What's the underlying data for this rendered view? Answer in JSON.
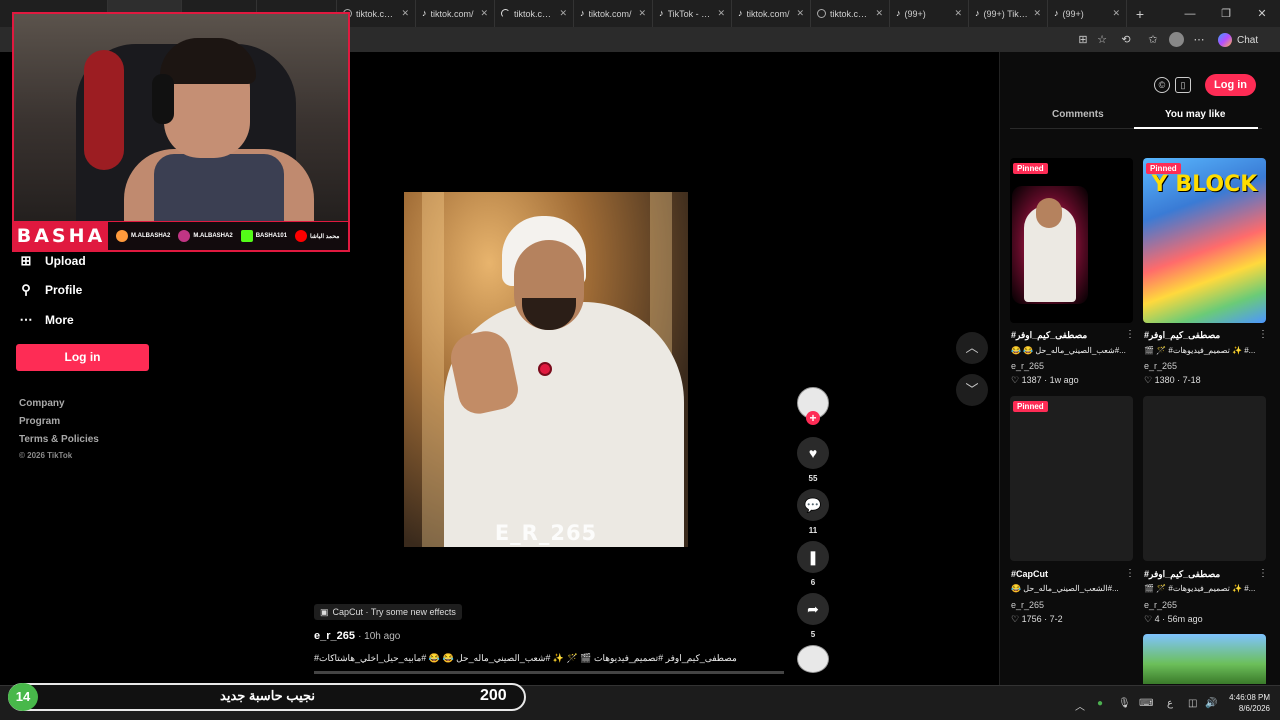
{
  "browser": {
    "tabs": [
      {
        "label": "tiktok.com/",
        "icon": "globe-icon"
      },
      {
        "label": "tiktok.com/",
        "icon": "tiktok-icon"
      },
      {
        "label": "tiktok.com/",
        "icon": "loading-icon"
      },
      {
        "label": "tiktok.com/",
        "icon": "tiktok-icon"
      },
      {
        "label": "TikTok - Ma",
        "icon": "tiktok-icon"
      },
      {
        "label": "tiktok.com/",
        "icon": "tiktok-icon"
      },
      {
        "label": "tiktok.com/",
        "icon": "globe-icon"
      },
      {
        "label": "(99+)",
        "icon": "tiktok-icon"
      },
      {
        "label": "(99+) TikTok",
        "icon": "tiktok-icon"
      },
      {
        "label": "(99+)",
        "icon": "tiktok-icon"
      }
    ],
    "chat_label": "Chat"
  },
  "webcam": {
    "brand": "BASHA",
    "socials": [
      {
        "handle": "M.ALBASHA2",
        "color": "#ff9a3c"
      },
      {
        "handle": "M.ALBASHA2",
        "color": "#c13584"
      },
      {
        "handle": "BASHA101",
        "color": "#53fc18"
      },
      {
        "handle": "محمد الباشا",
        "color": "#ff0000"
      }
    ]
  },
  "left_nav": {
    "items": [
      {
        "label": "Upload",
        "icon": "plus-square-icon"
      },
      {
        "label": "Profile",
        "icon": "person-icon"
      },
      {
        "label": "More",
        "icon": "ellipsis-icon"
      }
    ],
    "login_label": "Log in",
    "footer": [
      "Company",
      "Program",
      "Terms & Policies"
    ],
    "copyright": "© 2026 TikTok"
  },
  "video": {
    "watermark": "E_R_265",
    "effect_chip": "CapCut · Try some new effects",
    "author": "e_r_265",
    "posted": "· 10h ago",
    "caption": "#مصطفى_كيم_اوفر #تصميم_فيديوهات 🎬 🪄 ✨ #شعب_الصيني_ماله_حل 😂 😂 #مابيه_حيل_اخلي_هاشتاكات",
    "likes": "55",
    "comments": "11",
    "saves": "6",
    "shares": "5"
  },
  "right_panel": {
    "login_label": "Log in",
    "tabs": [
      "Comments",
      "You may like"
    ],
    "cards": [
      {
        "pinned": "Pinned",
        "title": "#مصطفى_كيم_اوفر",
        "subtitle": "😂 😂 شعب_الصيني_ماله_حل#...",
        "author": "e_r_265",
        "stats": "♡ 1387 · 1w ago",
        "thumb_color": "#1a0e14"
      },
      {
        "pinned": "Pinned",
        "title": "#مصطفى_كيم_اوفر",
        "subtitle": "🎬 🪄 #تصميم_فيديوهات ✨ #...",
        "author": "e_r_265",
        "stats": "♡ 1380 · 7-18",
        "thumb_color": "#3b8cff",
        "thumb_text": "Y BLOCK"
      },
      {
        "pinned": "Pinned",
        "title": "#CapCut",
        "subtitle": "😂 الشعب_الصيني_ماله_حل#...",
        "author": "e_r_265",
        "stats": "♡ 1756 · 7-2",
        "thumb_color": "#1e1e1e"
      },
      {
        "pinned": "",
        "title": "#مصطفى_كيم_اوفر",
        "subtitle": "🎬 🪄 #تصميم_فيديوهات ✨ #...",
        "author": "e_r_265",
        "stats": "♡ 4 · 56m ago",
        "thumb_color": "#1e1e1e"
      }
    ]
  },
  "stream_overlay": {
    "level": "14",
    "text": "نجيب حاسبة جديد",
    "count": "200"
  },
  "taskbar": {
    "time": "4:46:08 PM",
    "date": "8/6/2026",
    "lang": "ع"
  }
}
